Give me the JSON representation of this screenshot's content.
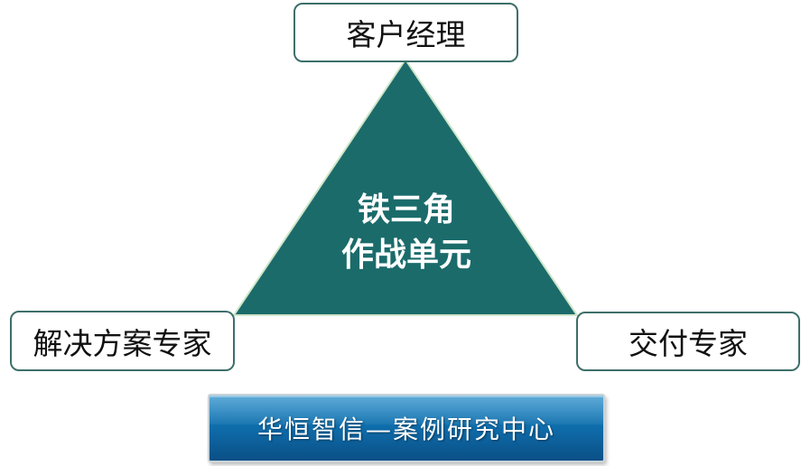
{
  "diagram": {
    "center": {
      "line1": "铁三角",
      "line2": "作战单元"
    },
    "nodes": {
      "top": "客户经理",
      "left": "解决方案专家",
      "right": "交付专家"
    }
  },
  "banner": {
    "text": "华恒智信—案例研究中心"
  },
  "colors": {
    "triangle_fill": "#1b6b6b",
    "box_border": "#3d6f6a",
    "banner_blue": "#0f6fad"
  }
}
